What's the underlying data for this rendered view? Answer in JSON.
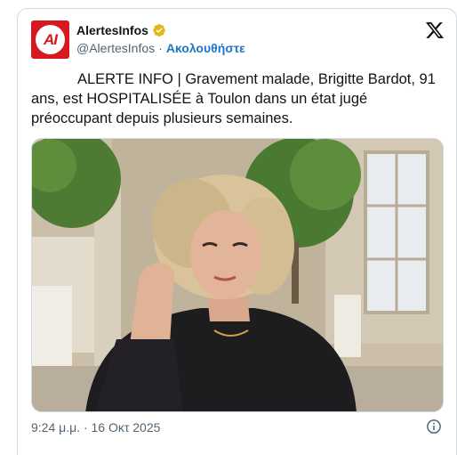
{
  "account": {
    "display_name": "AlertesInfos",
    "handle": "@AlertesInfos",
    "separator": "·",
    "follow_label": "Ακολουθήστε",
    "avatar_text": "AI"
  },
  "tweet": {
    "text": "ALERTE INFO | Gravement malade, Brigitte Bardot, 91 ans, est HOSPITALISÉE à Toulon dans un état jugé préoccupant depuis plusieurs semaines.",
    "timestamp": "9:24 μ.μ. · 16 Οκτ 2025"
  },
  "icons": {
    "verified": "verified-badge-icon",
    "x_logo": "x-logo-icon",
    "info": "info-icon"
  },
  "colors": {
    "brand_red": "#d7191f",
    "follow_blue": "#1d77c7",
    "verified_gold": "#e2b719",
    "muted_text": "#536471",
    "border": "#cfd9de"
  }
}
